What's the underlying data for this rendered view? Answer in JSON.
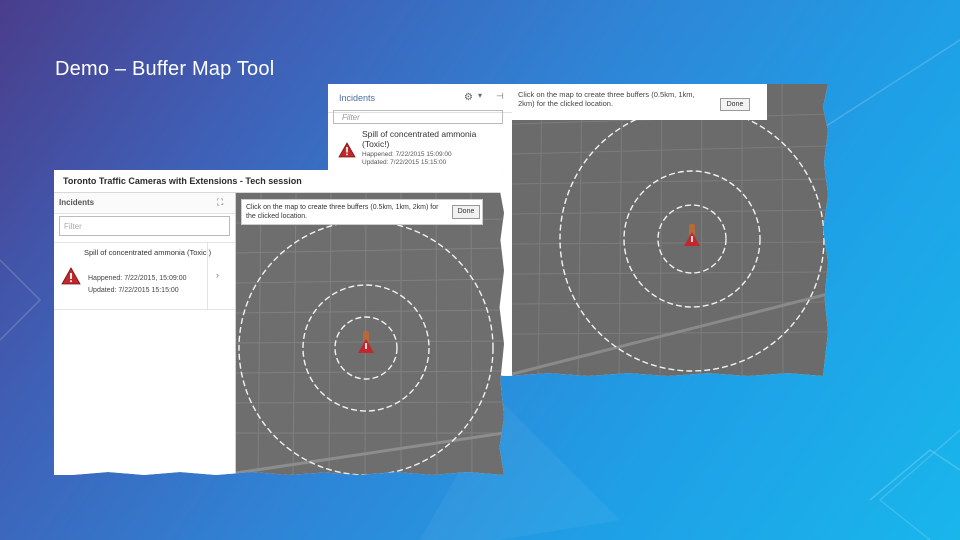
{
  "slide": {
    "title": "Demo – Buffer Map Tool"
  },
  "screenshot_back": {
    "panel_title": "Incidents",
    "filter_placeholder": "Filter",
    "incident": {
      "title": "Spill of concentrated ammonia (Toxic!)",
      "happened": "Happened: 7/22/2015 15:09:00",
      "updated": "Updated: 7/22/2015 15:15:00"
    },
    "map_message": "Click on the map to create three buffers (0.5km, 1km, 2km) for the clicked location.",
    "done_label": "Done"
  },
  "screenshot_front": {
    "window_title": "Toronto Traffic Cameras with Extensions - Tech session",
    "panel_title": "Incidents",
    "filter_placeholder": "Filter",
    "incident": {
      "title": "Spill of concentrated ammonia (Toxic!)",
      "happened": "Happened: 7/22/2015, 15:09:00",
      "updated": "Updated: 7/22/2015 15:15:00"
    },
    "map_message": "Click on the map to create three buffers (0.5km, 1km, 2km) for the clicked location.",
    "done_label": "Done"
  },
  "colors": {
    "map_gray": "#6b6b6b",
    "warning_red": "#c0282d",
    "incident_marker": "#b8693a"
  },
  "icons": {
    "warning": "warning-triangle-icon",
    "settings": "gear-icon",
    "expand": "expand-icon",
    "chevron": "chevron-right-icon"
  }
}
